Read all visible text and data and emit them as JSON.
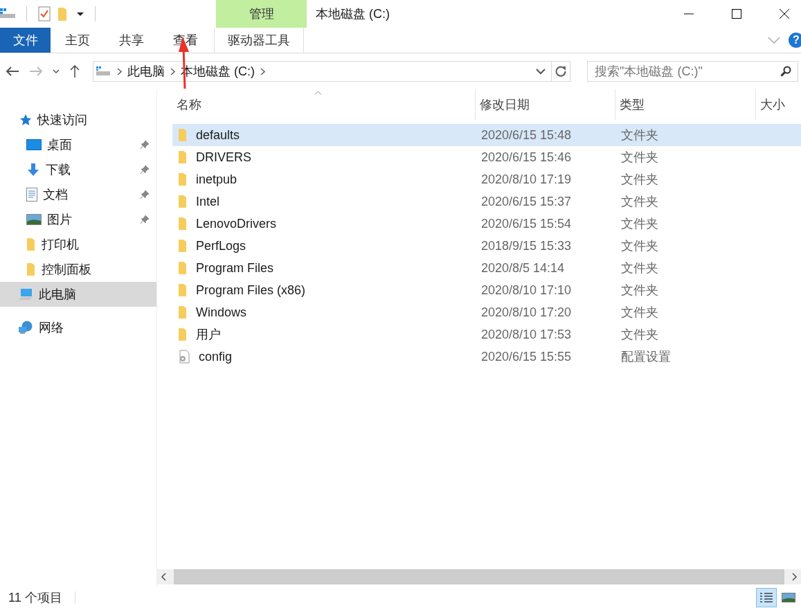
{
  "window": {
    "title": "本地磁盘 (C:)",
    "context_tab_group": "管理"
  },
  "ribbon": {
    "tabs": [
      {
        "label": "文件",
        "kind": "file",
        "selected": false
      },
      {
        "label": "主页",
        "kind": "tab",
        "selected": false
      },
      {
        "label": "共享",
        "kind": "tab",
        "selected": false
      },
      {
        "label": "查看",
        "kind": "tab",
        "selected": false
      },
      {
        "label": "驱动器工具",
        "kind": "context",
        "selected": false
      }
    ]
  },
  "help": "?",
  "address_bar": {
    "crumbs": [
      "此电脑",
      "本地磁盘 (C:)"
    ]
  },
  "search": {
    "placeholder": "搜索\"本地磁盘 (C:)\""
  },
  "sidebar": {
    "items": [
      {
        "label": "快速访问",
        "kind": "star",
        "selected": false,
        "children": [
          {
            "label": "桌面",
            "kind": "desktop",
            "pinned": true,
            "selected": false
          },
          {
            "label": "下载",
            "kind": "download",
            "pinned": true,
            "selected": false
          },
          {
            "label": "文档",
            "kind": "document",
            "pinned": true,
            "selected": false
          },
          {
            "label": "图片",
            "kind": "image",
            "pinned": true,
            "selected": false
          },
          {
            "label": "打印机",
            "kind": "folder",
            "pinned": false,
            "selected": false
          },
          {
            "label": "控制面板",
            "kind": "folder",
            "pinned": false,
            "selected": false
          }
        ]
      },
      {
        "label": "此电脑",
        "kind": "computer",
        "selected": true
      },
      {
        "label": "网络",
        "kind": "network",
        "selected": false
      }
    ]
  },
  "table": {
    "columns": [
      {
        "label": "名称",
        "sorted": true
      },
      {
        "label": "修改日期",
        "sorted": false
      },
      {
        "label": "类型",
        "sorted": false
      },
      {
        "label": "大小",
        "sorted": false
      }
    ],
    "rows": [
      {
        "name": "defaults",
        "date": "2020/6/15 15:48",
        "type": "文件夹",
        "kind": "folder",
        "selected": true
      },
      {
        "name": "DRIVERS",
        "date": "2020/6/15 15:46",
        "type": "文件夹",
        "kind": "folder",
        "selected": false
      },
      {
        "name": "inetpub",
        "date": "2020/8/10 17:19",
        "type": "文件夹",
        "kind": "folder",
        "selected": false
      },
      {
        "name": "Intel",
        "date": "2020/6/15 15:37",
        "type": "文件夹",
        "kind": "folder",
        "selected": false
      },
      {
        "name": "LenovoDrivers",
        "date": "2020/6/15 15:54",
        "type": "文件夹",
        "kind": "folder",
        "selected": false
      },
      {
        "name": "PerfLogs",
        "date": "2018/9/15 15:33",
        "type": "文件夹",
        "kind": "folder",
        "selected": false
      },
      {
        "name": "Program Files",
        "date": "2020/8/5 14:14",
        "type": "文件夹",
        "kind": "folder",
        "selected": false
      },
      {
        "name": "Program Files (x86)",
        "date": "2020/8/10 17:10",
        "type": "文件夹",
        "kind": "folder",
        "selected": false
      },
      {
        "name": "Windows",
        "date": "2020/8/10 17:20",
        "type": "文件夹",
        "kind": "folder",
        "selected": false
      },
      {
        "name": "用户",
        "date": "2020/8/10 17:53",
        "type": "文件夹",
        "kind": "folder",
        "selected": false
      },
      {
        "name": "config",
        "date": "2020/6/15 15:55",
        "type": "配置设置",
        "kind": "settings",
        "selected": false
      }
    ]
  },
  "status_bar": {
    "count": "11 个项目",
    "views": [
      {
        "kind": "details",
        "selected": true
      },
      {
        "kind": "thumbnails",
        "selected": false
      }
    ]
  }
}
